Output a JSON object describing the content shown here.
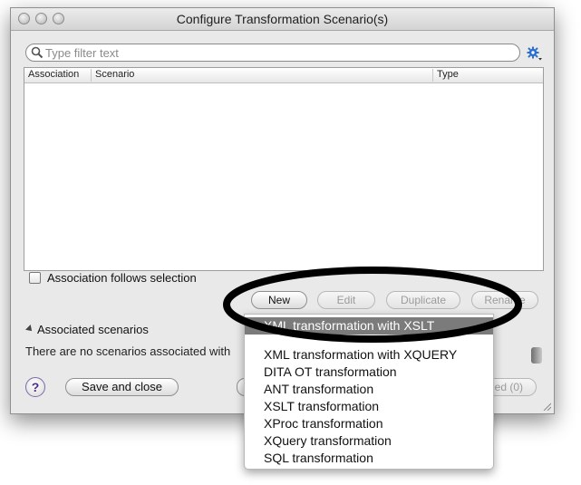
{
  "window": {
    "title": "Configure Transformation Scenario(s)"
  },
  "filter": {
    "placeholder": "Type filter text",
    "value": ""
  },
  "table": {
    "columns": [
      "Association",
      "Scenario",
      "Type"
    ],
    "rows": []
  },
  "checkbox": {
    "label": "Association follows selection",
    "checked": false
  },
  "actions": {
    "new": "New",
    "edit": "Edit",
    "duplicate": "Duplicate",
    "rename": "Rename"
  },
  "associated": {
    "section_label": "Associated scenarios",
    "message": "There are no scenarios associated with"
  },
  "footer": {
    "help": "?",
    "save_close": "Save and close",
    "apply": "ed (0)"
  },
  "new_menu": {
    "items": [
      "XML transformation with XSLT",
      "XML transformation with XQUERY",
      "DITA OT transformation",
      "ANT transformation",
      "XSLT transformation",
      "XProc transformation",
      "XQuery transformation",
      "SQL transformation"
    ],
    "selected_index": 0
  },
  "colors": {
    "selection": "#7b7b7b",
    "annotation_ellipse": "#000000",
    "help_icon": "#4b2f87",
    "gear_icon": "#2a6fd1"
  },
  "icons": {
    "search": "search-icon",
    "gear": "gear-icon",
    "help": "help-icon",
    "disclosure": "disclosure-triangle-icon",
    "resize": "resize-grip-icon"
  }
}
